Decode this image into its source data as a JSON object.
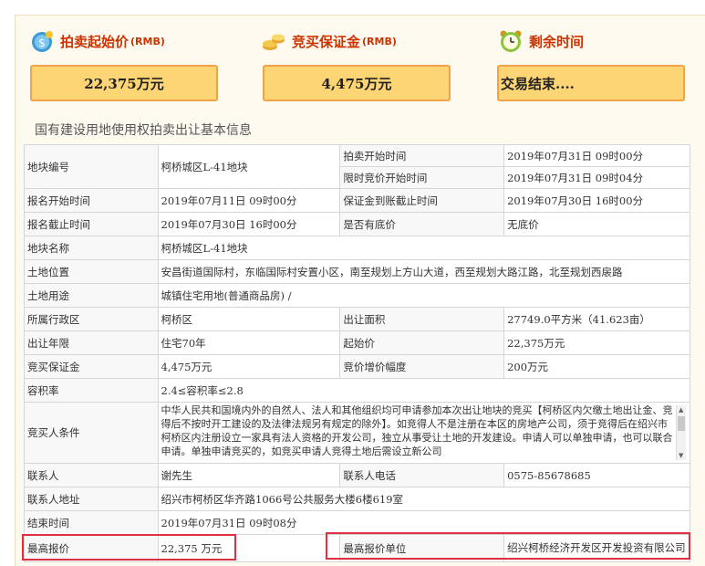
{
  "headers": {
    "start_price": {
      "label": "拍卖起始价",
      "unit": "(RMB)",
      "value": "22,375万元",
      "icon": "money-bag-icon"
    },
    "deposit": {
      "label": "竞买保证金",
      "unit": "(RMB)",
      "value": "4,475万元",
      "icon": "coins-icon"
    },
    "remaining": {
      "label": "剩余时间",
      "value": "交易结束....",
      "icon": "alarm-clock-icon"
    }
  },
  "section_title": "国有建设用地使用权拍卖出让基本信息",
  "table": {
    "plot_no_label": "地块编号",
    "plot_no": "柯桥城区L-41地块",
    "auction_start_label": "拍卖开始时间",
    "auction_start": "2019年07月31日 09时00分",
    "timed_bid_label": "限时竞价开始时间",
    "timed_bid": "2019年07月31日 09时04分",
    "reg_start_label": "报名开始时间",
    "reg_start": "2019年07月11日 09时00分",
    "deposit_deadline_label": "保证金到账截止时间",
    "deposit_deadline": "2019年07月30日 16时00分",
    "reg_end_label": "报名截止时间",
    "reg_end": "2019年07月30日 16时00分",
    "reserve_label": "是否有底价",
    "reserve": "无底价",
    "plot_name_label": "地块名称",
    "plot_name": "柯桥城区L-41地块",
    "location_label": "土地位置",
    "location": "安昌街道国际村，东临国际村安置小区，南至规划上方山大道，西至规划大路江路，北至规划西扆路",
    "usage_label": "土地用途",
    "usage": "城镇住宅用地(普通商品房) /",
    "district_label": "所属行政区",
    "district": "柯桥区",
    "area_label": "出让面积",
    "area": "27749.0平方米（41.623亩）",
    "term_label": "出让年限",
    "term": "住宅70年",
    "start_price_label": "起始价",
    "start_price": "22,375万元",
    "deposit_label": "竞买保证金",
    "deposit": "4,475万元",
    "increment_label": "竞价增价幅度",
    "increment": "200万元",
    "far_label": "容积率",
    "far": "2.4≤容积率≤2.8",
    "conditions_label": "竞买人条件",
    "conditions": "中华人民共和国境内外的自然人、法人和其他组织均可申请参加本次出让地块的竞买【柯桥区内欠缴土地出让金、竞得后不按时开工建设的及法律法规另有规定的除外】。如竞得人不是注册在本区的房地产公司，须于竞得后在绍兴市柯桥区内注册设立一家具有法人资格的开发公司，独立从事受让土地的开发建设。申请人可以单独申请，也可以联合申请。单独申请竞买的，如竞买申请人竞得土地后需设立新公司",
    "contact_label": "联系人",
    "contact": "谢先生",
    "phone_label": "联系人电话",
    "phone": "0575-85678685",
    "address_label": "联系人地址",
    "address": "绍兴市柯桥区华齐路1066号公共服务大楼6楼619室",
    "end_time_label": "结束时间",
    "end_time": "2019年07月31日 09时08分",
    "top_bid_label": "最高报价",
    "top_bid": "22,375 万元",
    "top_bidder_label": "最高报价单位",
    "top_bidder": "绍兴柯桥经济开发区开发投资有限公司"
  }
}
